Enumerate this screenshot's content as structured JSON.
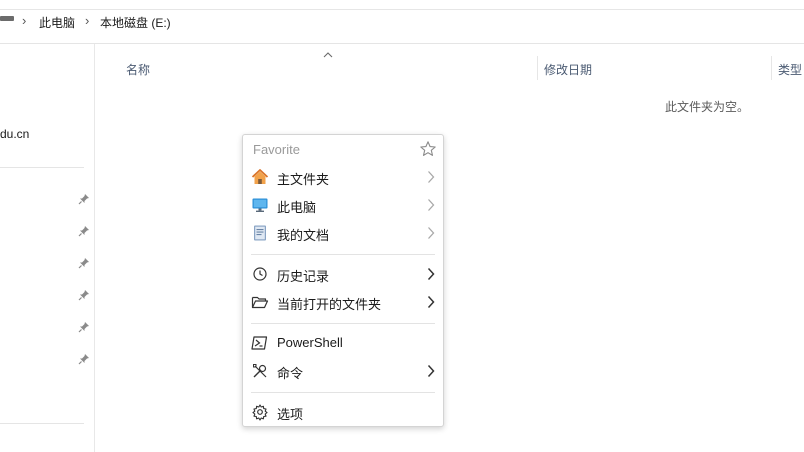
{
  "breadcrumb": {
    "items": [
      "此电脑",
      "本地磁盘 (E:)"
    ],
    "separator": "›"
  },
  "sidebar": {
    "partial_item": "du.cn"
  },
  "columns": {
    "name": "名称",
    "modified": "修改日期",
    "type": "类型"
  },
  "content": {
    "empty_message": "此文件夹为空。"
  },
  "context_menu": {
    "header": "Favorite",
    "items": [
      {
        "label": "主文件夹",
        "icon": "home-icon",
        "arrow": "light"
      },
      {
        "label": "此电脑",
        "icon": "monitor-icon",
        "arrow": "light"
      },
      {
        "label": "我的文档",
        "icon": "document-icon",
        "arrow": "light"
      },
      {
        "label": "历史记录",
        "icon": "clock-icon",
        "arrow": "dark"
      },
      {
        "label": "当前打开的文件夹",
        "icon": "folder-open-icon",
        "arrow": "dark"
      },
      {
        "label": "PowerShell",
        "icon": "powershell-icon",
        "arrow": "none"
      },
      {
        "label": "命令",
        "icon": "tools-icon",
        "arrow": "dark"
      },
      {
        "label": "选项",
        "icon": "gear-icon",
        "arrow": "none"
      }
    ]
  },
  "colors": {
    "header_text": "#4a5a72",
    "menu_header": "#9a9a9a",
    "monitor_blue": "#2b8fd6",
    "home_orange": "#e8852e"
  }
}
